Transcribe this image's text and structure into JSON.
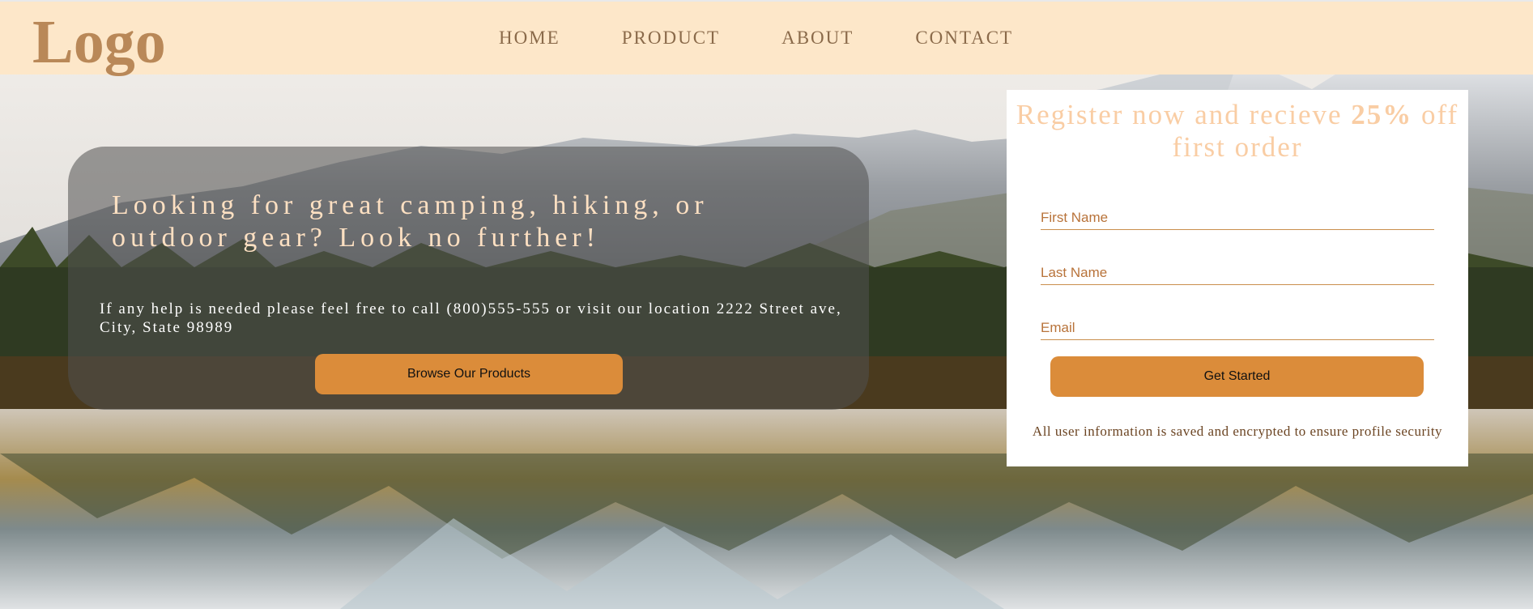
{
  "header": {
    "logo": "Logo",
    "nav": [
      {
        "label": "HOME"
      },
      {
        "label": "PRODUCT"
      },
      {
        "label": "ABOUT"
      },
      {
        "label": "CONTACT"
      }
    ]
  },
  "hero": {
    "title": "Looking for great camping, hiking, or outdoor gear? Look no further!",
    "subtitle": "If any help is needed please feel free to call (800)555-555 or visit our location 2222 Street ave, City, State 98989",
    "button_label": "Browse Our Products"
  },
  "register": {
    "title_prefix": "Register now and recieve ",
    "title_bold": "25%",
    "title_suffix": " off first order",
    "fields": [
      {
        "placeholder": "First Name"
      },
      {
        "placeholder": "Last Name"
      },
      {
        "placeholder": "Email"
      }
    ],
    "button_label": "Get Started",
    "note": "All user information is saved and encrypted to ensure profile security"
  },
  "colors": {
    "header_bg": "#fde7c9",
    "logo": "#b98858",
    "accent_button": "#db8c3a",
    "card_title": "#f9cda4"
  },
  "background": {
    "icon": "mountain-lake-photo"
  }
}
